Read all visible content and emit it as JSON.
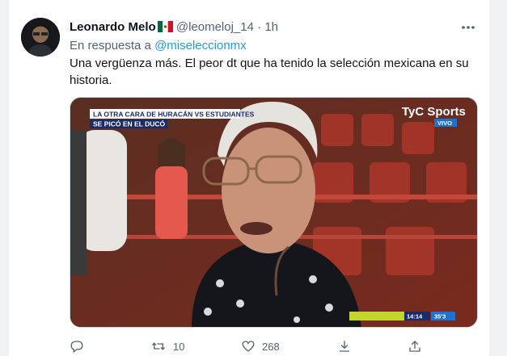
{
  "tweet": {
    "author_name": "Leonardo Melo",
    "author_handle": "@leomeloj_14",
    "separator": "·",
    "time": "1h",
    "reply_prefix": "En respuesta a",
    "reply_mention": "@miseleccionmx",
    "text": "Una vergüenza más. El peor dt que ha tenido la selección mexicana en su historia.",
    "media": {
      "banner_line1": "LA OTRA CARA DE HURACÁN VS ESTUDIANTES",
      "banner_line2": "SE PICÓ EN EL DUCÓ",
      "logo_text": "TyC Sports",
      "live_label": "VIVO",
      "score_text": "14:14",
      "score_minute": "35'3"
    },
    "actions": {
      "retweets": "10",
      "likes": "268"
    }
  },
  "icons": {
    "reply": "reply-icon",
    "retweet": "retweet-icon",
    "like": "heart-icon",
    "share": "share-icon",
    "more": "more-icon",
    "flag": "mexico-flag-icon"
  },
  "colors": {
    "accent": "#1d9bf0",
    "secondary_text": "#536471",
    "primary_text": "#0f1419"
  }
}
